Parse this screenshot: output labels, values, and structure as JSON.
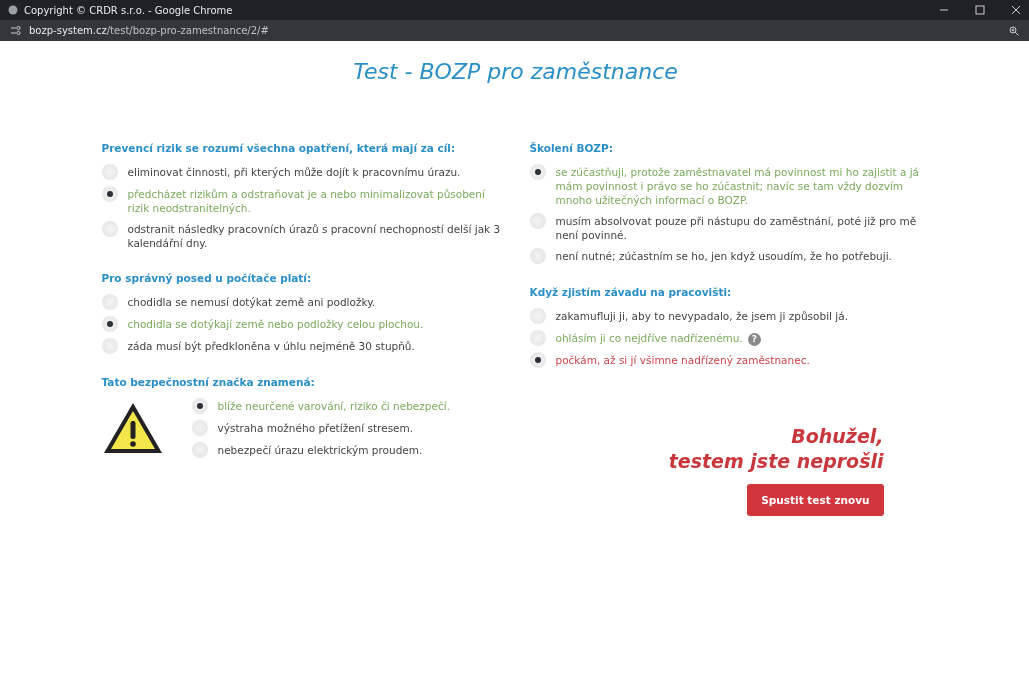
{
  "window": {
    "title": "Copyright © CRDR s.r.o. - Google Chrome",
    "url_host": "bozp-system.cz",
    "url_path": "/test/bozp-pro-zamestnance/2/#"
  },
  "page_title": "Test - BOZP pro zaměstnance",
  "columns": [
    {
      "questions": [
        {
          "question": "Prevencí rizik se rozumí všechna opatření, která mají za cíl:",
          "kind": "text",
          "answers": [
            {
              "text": "eliminovat činnosti, při kterých může dojít k pracovnímu úrazu.",
              "selected": false,
              "color": "#444444"
            },
            {
              "text": "předcházet rizikům a odstraňovat je a nebo minimalizovat působení rizik neodstranitelných.",
              "selected": true,
              "color": "#7aaa5c"
            },
            {
              "text": "odstranit následky pracovních úrazů s pracovní nechopností delší jak 3 kalendářní dny.",
              "selected": false,
              "color": "#444444"
            }
          ]
        },
        {
          "question": "Pro správný posed u počítače platí:",
          "kind": "text",
          "answers": [
            {
              "text": "chodidla se nemusí dotýkat země ani podložky.",
              "selected": false,
              "color": "#444444"
            },
            {
              "text": "chodidla se dotýkají země nebo podložky celou plochou.",
              "selected": true,
              "color": "#7aaa5c"
            },
            {
              "text": "záda musí být předkloněna v úhlu nejméně 30 stupňů.",
              "selected": false,
              "color": "#444444"
            }
          ]
        },
        {
          "question": "Tato bezpečnostní značka znamená:",
          "kind": "sign",
          "answers": [
            {
              "text": "blíže neurčené varování, riziko či nebezpečí.",
              "selected": true,
              "color": "#7aaa5c"
            },
            {
              "text": "výstraha možného přetížení stresem.",
              "selected": false,
              "color": "#444444"
            },
            {
              "text": "nebezpečí úrazu elektrickým proudem.",
              "selected": false,
              "color": "#444444"
            }
          ]
        }
      ]
    },
    {
      "questions": [
        {
          "question": "Školení BOZP:",
          "kind": "text",
          "answers": [
            {
              "text": "se zúčastňuji, protože zaměstnavatel má povinnost mi ho zajistit a já mám povinnost i právo se ho zúčastnit; navíc se tam vždy dozvím mnoho užitečných informací o BOZP.",
              "selected": true,
              "color": "#7aaa5c"
            },
            {
              "text": "musím absolvovat pouze při nástupu do zaměstnání, poté již pro mě není povinné.",
              "selected": false,
              "color": "#444444"
            },
            {
              "text": "není nutné; zúčastním se ho, jen když usoudím, že ho potřebuji.",
              "selected": false,
              "color": "#444444"
            }
          ]
        },
        {
          "question": "Když zjistím závadu na pracovišti:",
          "kind": "text",
          "answers": [
            {
              "text": "zakamufluji ji, aby to nevypadalo, že jsem ji způsobil já.",
              "selected": false,
              "color": "#444444"
            },
            {
              "text": "ohlásím ji co nejdříve nadřízenému.",
              "selected": false,
              "color": "#7aaa5c",
              "help": "?"
            },
            {
              "text": "počkám, až si jí všimne nadřízený zaměstnanec.",
              "selected": true,
              "color": "#c9444b"
            }
          ]
        }
      ]
    }
  ],
  "result": {
    "lines": [
      "Bohužel,",
      "testem jste neprošli"
    ],
    "button": "Spustit test znovu"
  }
}
